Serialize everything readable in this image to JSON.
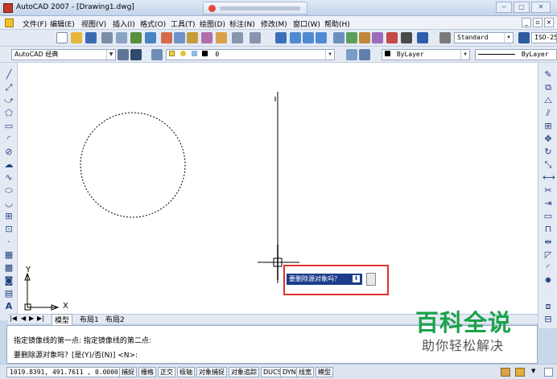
{
  "window": {
    "title": "AutoCAD 2007 - [Drawing1.dwg]",
    "min_glyph": "−",
    "max_glyph": "▢",
    "close_glyph": "✕"
  },
  "menu": {
    "items": [
      "文件(F)",
      "编辑(E)",
      "视图(V)",
      "插入(I)",
      "格式(O)",
      "工具(T)",
      "绘图(D)",
      "标注(N)",
      "修改(M)",
      "窗口(W)",
      "帮助(H)"
    ]
  },
  "toolbar": {
    "text_style": "Standard",
    "dim_style": "ISO-25",
    "workspace": "AutoCAD 经典",
    "layer": "0",
    "color": "ByLayer",
    "linetype": "ByLayer"
  },
  "canvas": {
    "ucs_x": "X",
    "ucs_y": "Y"
  },
  "prompt": {
    "text": "要删除源对象吗？",
    "arrow": "⬇"
  },
  "layout_tabs": [
    "模型",
    "布局1",
    "布局2"
  ],
  "command": {
    "line1": "指定镜像线的第一点: 指定镜像线的第二点:",
    "line2": "要删除源对象吗？[是(Y)/否(N)] <N>:"
  },
  "status": {
    "coords": "1019.8391, 491.7611 , 0.0000",
    "buttons": [
      "捕捉",
      "栅格",
      "正交",
      "极轴",
      "对象捕捉",
      "对象追踪",
      "DUCS",
      "DYN",
      "线宽",
      "模型"
    ]
  },
  "watermark": {
    "title": "百科全说",
    "subtitle": "助你轻松解决"
  },
  "colors": {
    "accent_red": "#e0332b",
    "prompt_blue": "#1c3d8c",
    "watermark_green": "#1aa34a"
  }
}
